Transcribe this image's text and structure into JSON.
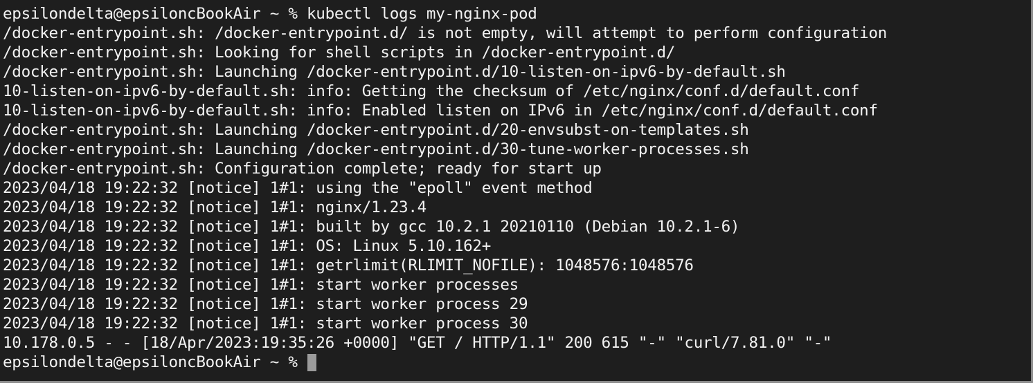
{
  "terminal": {
    "lines": [
      "epsilondelta@epsiloncBookAir ~ % kubectl logs my-nginx-pod",
      "/docker-entrypoint.sh: /docker-entrypoint.d/ is not empty, will attempt to perform configuration",
      "/docker-entrypoint.sh: Looking for shell scripts in /docker-entrypoint.d/",
      "/docker-entrypoint.sh: Launching /docker-entrypoint.d/10-listen-on-ipv6-by-default.sh",
      "10-listen-on-ipv6-by-default.sh: info: Getting the checksum of /etc/nginx/conf.d/default.conf",
      "10-listen-on-ipv6-by-default.sh: info: Enabled listen on IPv6 in /etc/nginx/conf.d/default.conf",
      "/docker-entrypoint.sh: Launching /docker-entrypoint.d/20-envsubst-on-templates.sh",
      "/docker-entrypoint.sh: Launching /docker-entrypoint.d/30-tune-worker-processes.sh",
      "/docker-entrypoint.sh: Configuration complete; ready for start up",
      "2023/04/18 19:22:32 [notice] 1#1: using the \"epoll\" event method",
      "2023/04/18 19:22:32 [notice] 1#1: nginx/1.23.4",
      "2023/04/18 19:22:32 [notice] 1#1: built by gcc 10.2.1 20210110 (Debian 10.2.1-6)",
      "2023/04/18 19:22:32 [notice] 1#1: OS: Linux 5.10.162+",
      "2023/04/18 19:22:32 [notice] 1#1: getrlimit(RLIMIT_NOFILE): 1048576:1048576",
      "2023/04/18 19:22:32 [notice] 1#1: start worker processes",
      "2023/04/18 19:22:32 [notice] 1#1: start worker process 29",
      "2023/04/18 19:22:32 [notice] 1#1: start worker process 30",
      "10.178.0.5 - - [18/Apr/2023:19:35:26 +0000] \"GET / HTTP/1.1\" 200 615 \"-\" \"curl/7.81.0\" \"-\""
    ],
    "prompt": "epsilondelta@epsiloncBookAir ~ % ",
    "colors": {
      "background": "#1e1e1e",
      "text": "#f2f2f2",
      "cursor": "#9b9b9b"
    }
  }
}
